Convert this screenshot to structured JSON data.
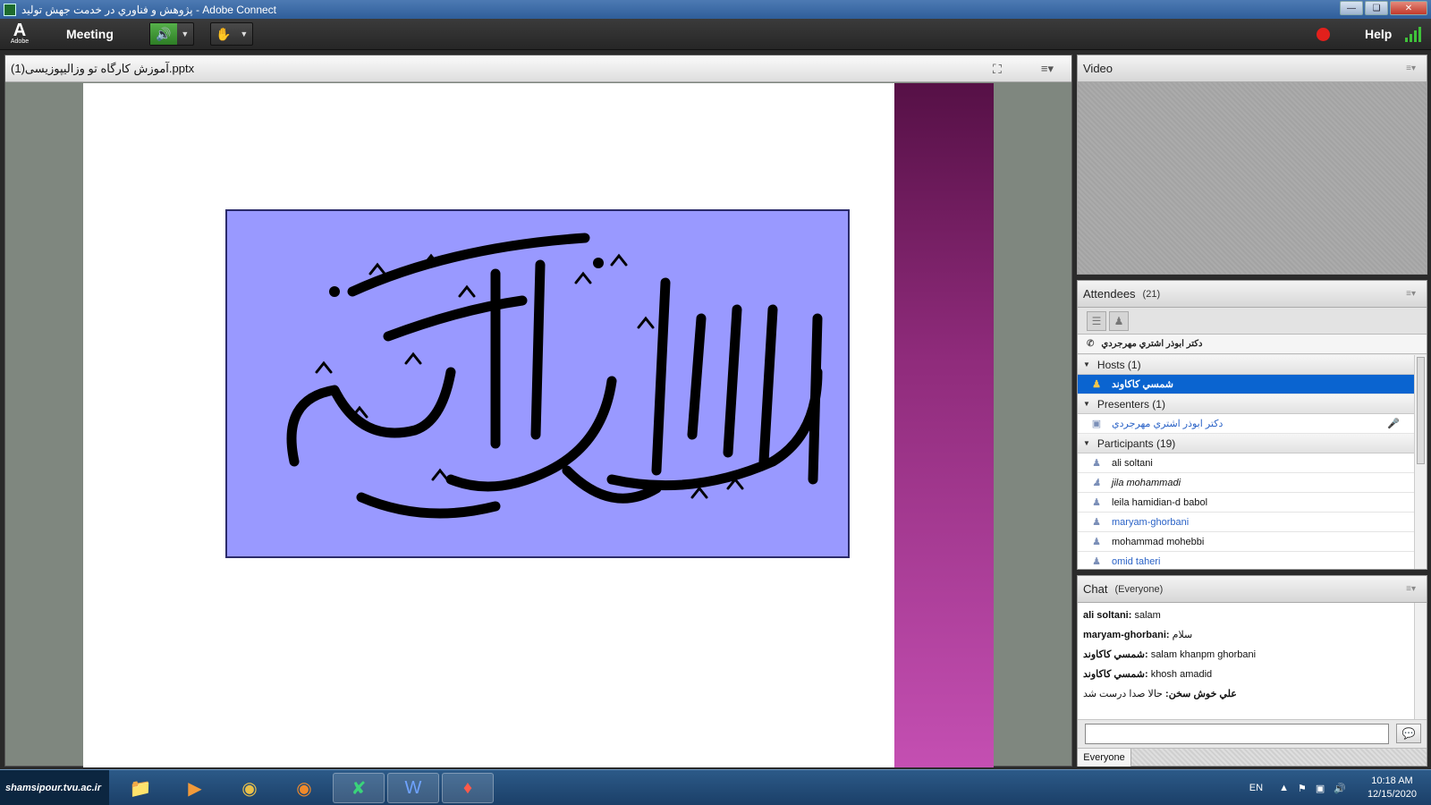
{
  "window": {
    "title": "پژوهش و فناوري در خدمت جهش توليد - Adobe Connect",
    "minimize_icon": "minimize-icon",
    "maximize_icon": "maximize-icon",
    "close_icon": "close-icon"
  },
  "toolbar": {
    "logo_text": "A",
    "logo_sub": "Adobe",
    "meeting_menu": "Meeting",
    "help": "Help",
    "speaker_icon": "speaker-icon",
    "camera_icon": "presenter-icon",
    "record_color": "#e2201c",
    "signal_color": "#3fc23a"
  },
  "share_pod": {
    "file_name": "آموزش کارگاه تو وزالیپوزیسی(1).pptx",
    "fullscreen_icon": "fullscreen-icon",
    "menu_icon": "pod-menu-icon",
    "slide_image": "bismillah-calligraphy-image",
    "slide_bg_color": "#9999ff",
    "band_color": "#8f2b7b"
  },
  "video_pod": {
    "title": "Video"
  },
  "attendees_pod": {
    "title": "Attendees",
    "count": "(21)",
    "caller_name": "دكتر ابوذر اشتري مهرجردي",
    "groups": {
      "hosts": {
        "label": "Hosts (1)",
        "members": [
          "شمسي كاكاوند"
        ]
      },
      "presenters": {
        "label": "Presenters (1)",
        "members": [
          "دكتر ابوذر اشتري مهرجردي"
        ]
      },
      "participants": {
        "label": "Participants (19)",
        "members": [
          "ali soltani",
          "jila mohammadi",
          "leila hamidian-d  babol",
          "maryam-ghorbani",
          "mohammad mohebbi",
          "omid taheri"
        ]
      }
    }
  },
  "chat_pod": {
    "title": "Chat",
    "scope": "(Everyone)",
    "messages": [
      {
        "sender": "ali soltani:",
        "text": "salam"
      },
      {
        "sender": "maryam-ghorbani:",
        "text": "سلام"
      },
      {
        "sender": "شمسي كاكاوند:",
        "text": "salam  khanpm ghorbani"
      },
      {
        "sender": "شمسي كاكاوند:",
        "text": "khosh amadid"
      },
      {
        "sender": "علي خوش سخن:",
        "text": "حالا صدا درست شد"
      }
    ],
    "input_value": "",
    "recipient_tab": "Everyone",
    "send_icon": "send-bubble-icon"
  },
  "taskbar": {
    "start_label": "shamsipour.tvu.ac.ir",
    "apps": [
      "file-explorer-icon",
      "media-player-icon",
      "chrome-icon",
      "firefox-icon",
      "adobe-connect-icon",
      "word-icon",
      "acrobat-icon"
    ],
    "language": "EN",
    "time": "10:18 AM",
    "date": "12/15/2020"
  }
}
